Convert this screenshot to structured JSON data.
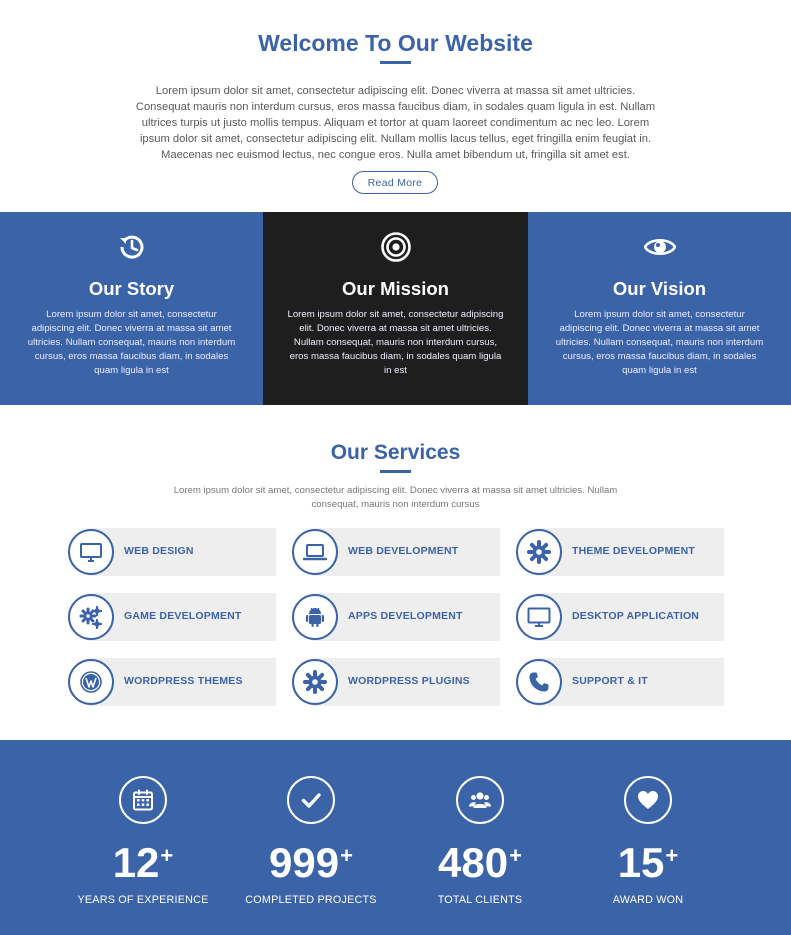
{
  "welcome": {
    "title": "Welcome To Our Website",
    "text": "Lorem ipsum dolor sit amet, consectetur adipiscing elit. Donec viverra at massa sit amet ultricies. Consequat mauris non interdum cursus, eros massa faucibus diam, in sodales quam ligula in est. Nullam ultrices turpis ut justo mollis tempus. Aliquam et tortor at quam laoreet condimentum ac nec leo. Lorem ipsum dolor sit amet, consectetur adipiscing elit. Nullam mollis lacus tellus, eget fringilla enim feugiat in. Maecenas nec euismod lectus, nec congue eros. Nulla amet bibendum ut, fringilla sit amet est.",
    "read_more": "Read More"
  },
  "panels": [
    {
      "icon": "history-icon",
      "title": "Our Story",
      "text": "Lorem ipsum dolor sit amet, consectetur adipiscing elit. Donec viverra at massa sit amet ultricies. Nullam consequat, mauris non interdum cursus, eros massa faucibus diam, in sodales quam ligula in est"
    },
    {
      "icon": "target-icon",
      "title": "Our Mission",
      "text": "Lorem ipsum dolor sit amet, consectetur adipiscing elit. Donec viverra at massa sit amet ultricies. Nullam consequat, mauris non interdum cursus, eros massa faucibus diam, in sodales quam ligula in est"
    },
    {
      "icon": "eye-icon",
      "title": "Our Vision",
      "text": "Lorem ipsum dolor sit amet, consectetur adipiscing elit. Donec viverra at massa sit amet ultricies. Nullam consequat, mauris non interdum cursus, eros massa faucibus diam, in sodales quam ligula in est"
    }
  ],
  "services": {
    "title": "Our Services",
    "subtitle": "Lorem ipsum dolor sit amet, consectetur adipiscing elit. Donec viverra at massa sit amet ultricies. Nullam consequat, mauris non interdum cursus",
    "items": [
      {
        "icon": "monitor-icon",
        "label": "WEB DESIGN"
      },
      {
        "icon": "laptop-icon",
        "label": "WEB DEVELOPMENT"
      },
      {
        "icon": "gear-icon",
        "label": "THEME DEVELOPMENT"
      },
      {
        "icon": "gears-icon",
        "label": "GAME DEVELOPMENT"
      },
      {
        "icon": "android-icon",
        "label": "APPS DEVELOPMENT"
      },
      {
        "icon": "desktop-icon",
        "label": "DESKTOP APPLICATION"
      },
      {
        "icon": "wordpress-icon",
        "label": "WORDPRESS THEMES"
      },
      {
        "icon": "cog-icon",
        "label": "WORDPRESS PLUGINS"
      },
      {
        "icon": "phone-icon",
        "label": "SUPPORT & IT"
      }
    ]
  },
  "stats": [
    {
      "icon": "calendar-icon",
      "number": "12",
      "plus": "+",
      "caption": "YEARS OF EXPERIENCE"
    },
    {
      "icon": "check-icon",
      "number": "999",
      "plus": "+",
      "caption": "COMPLETED PROJECTS"
    },
    {
      "icon": "users-icon",
      "number": "480",
      "plus": "+",
      "caption": "TOTAL CLIENTS"
    },
    {
      "icon": "heart-icon",
      "number": "15",
      "plus": "+",
      "caption": "AWARD WON"
    }
  ],
  "colors": {
    "brand": "#3b63a8",
    "dark": "#1e1e1e",
    "tile": "#eeeeee"
  }
}
